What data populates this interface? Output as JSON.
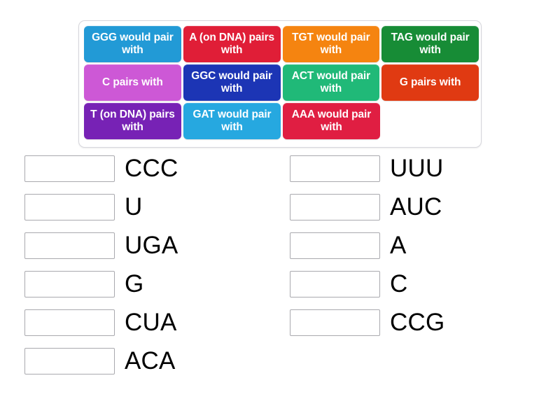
{
  "activity": {
    "type": "match-up-drag-and-drop",
    "topic": "DNA / RNA base pairing"
  },
  "tile_bank": {
    "rows": [
      [
        {
          "label": "GGG would pair with",
          "color": "#229ad6",
          "text_color": "#ffffff"
        },
        {
          "label": "A (on DNA) pairs with",
          "color": "#e01e37",
          "text_color": "#ffffff"
        },
        {
          "label": "TGT would pair with",
          "color": "#f58410",
          "text_color": "#ffffff"
        },
        {
          "label": "TAG would pair with",
          "color": "#178c36",
          "text_color": "#ffffff"
        }
      ],
      [
        {
          "label": "C pairs with",
          "color": "#cd58d6",
          "text_color": "#ffffff"
        },
        {
          "label": "GGC would pair with",
          "color": "#1c35b5",
          "text_color": "#ffffff"
        },
        {
          "label": "ACT would pair with",
          "color": "#20b978",
          "text_color": "#ffffff"
        },
        {
          "label": "G pairs with",
          "color": "#e03a12",
          "text_color": "#ffffff"
        }
      ],
      [
        {
          "label": "T (on DNA) pairs with",
          "color": "#7722b5",
          "text_color": "#ffffff"
        },
        {
          "label": "GAT would pair with",
          "color": "#26a8e0",
          "text_color": "#ffffff"
        },
        {
          "label": "AAA would pair with",
          "color": "#e01e42",
          "text_color": "#ffffff"
        }
      ]
    ]
  },
  "answers": {
    "left_column": [
      {
        "dropzone_value": "",
        "label": "CCC"
      },
      {
        "dropzone_value": "",
        "label": "U"
      },
      {
        "dropzone_value": "",
        "label": "UGA"
      },
      {
        "dropzone_value": "",
        "label": "G"
      },
      {
        "dropzone_value": "",
        "label": "CUA"
      },
      {
        "dropzone_value": "",
        "label": "ACA"
      }
    ],
    "right_column": [
      {
        "dropzone_value": "",
        "label": "UUU"
      },
      {
        "dropzone_value": "",
        "label": "AUC"
      },
      {
        "dropzone_value": "",
        "label": "A"
      },
      {
        "dropzone_value": "",
        "label": "C"
      },
      {
        "dropzone_value": "",
        "label": "CCG"
      }
    ]
  }
}
